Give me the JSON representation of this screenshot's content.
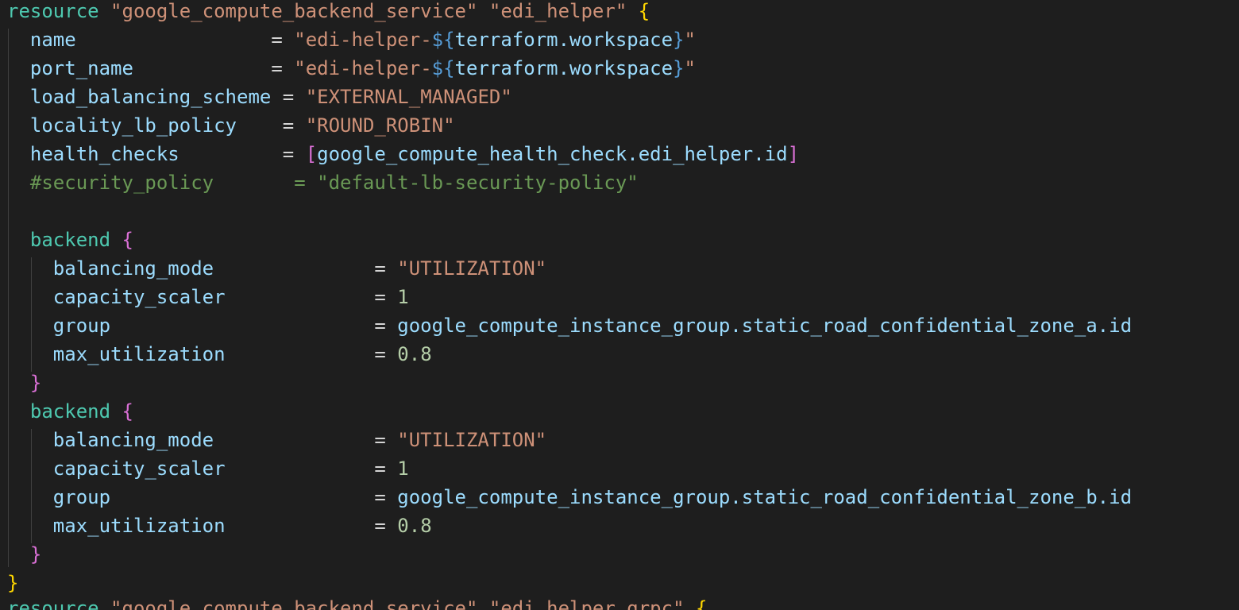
{
  "editor": {
    "language": "terraform",
    "colors": {
      "background": "#1e1e1e",
      "keyword": "#4ec9b0",
      "string": "#ce9178",
      "attribute": "#9cdcfe",
      "number": "#b5cea8",
      "comment": "#6a9955",
      "bracket_level1": "#ffd700",
      "bracket_level2": "#da70d6"
    }
  },
  "code": {
    "resource1": {
      "keyword": "resource",
      "type": "\"google_compute_backend_service\"",
      "name": "\"edi_helper\"",
      "open": "{",
      "close": "}"
    },
    "attrs": {
      "name_key": "name",
      "name_pad": "                 = ",
      "name_pre": "\"edi-helper-",
      "name_interp_open": "${",
      "name_ref": "terraform.workspace",
      "name_interp_close": "}",
      "name_post": "\"",
      "port_key": "port_name",
      "port_pad": "            = ",
      "port_pre": "\"edi-helper-",
      "port_interp_open": "${",
      "port_ref": "terraform.workspace",
      "port_interp_close": "}",
      "port_post": "\"",
      "lbs_key": "load_balancing_scheme",
      "lbs_pad": " = ",
      "lbs_val": "\"EXTERNAL_MANAGED\"",
      "llp_key": "locality_lb_policy",
      "llp_pad": "    = ",
      "llp_val": "\"ROUND_ROBIN\"",
      "hc_key": "health_checks",
      "hc_pad": "         = ",
      "hc_open": "[",
      "hc_val": "google_compute_health_check.edi_helper.id",
      "hc_close": "]",
      "comment": "#security_policy       = \"default-lb-security-policy\""
    },
    "backends": [
      {
        "keyword": "backend",
        "open": "{",
        "close": "}",
        "balancing_mode_key": "balancing_mode",
        "balancing_mode_pad": "              = ",
        "balancing_mode_val": "\"UTILIZATION\"",
        "capacity_key": "capacity_scaler",
        "capacity_pad": "             = ",
        "capacity_val": "1",
        "group_key": "group",
        "group_pad": "                       = ",
        "group_val": "google_compute_instance_group.static_road_confidential_zone_a.id",
        "maxu_key": "max_utilization",
        "maxu_pad": "             = ",
        "maxu_val": "0.8"
      },
      {
        "keyword": "backend",
        "open": "{",
        "close": "}",
        "balancing_mode_key": "balancing_mode",
        "balancing_mode_pad": "              = ",
        "balancing_mode_val": "\"UTILIZATION\"",
        "capacity_key": "capacity_scaler",
        "capacity_pad": "             = ",
        "capacity_val": "1",
        "group_key": "group",
        "group_pad": "                       = ",
        "group_val": "google_compute_instance_group.static_road_confidential_zone_b.id",
        "maxu_key": "max_utilization",
        "maxu_pad": "             = ",
        "maxu_val": "0.8"
      }
    ],
    "resource2": {
      "keyword": "resource",
      "type": "\"google_compute_backend_service\"",
      "name": "\"edi_helper_grpc\"",
      "open": "{"
    }
  }
}
